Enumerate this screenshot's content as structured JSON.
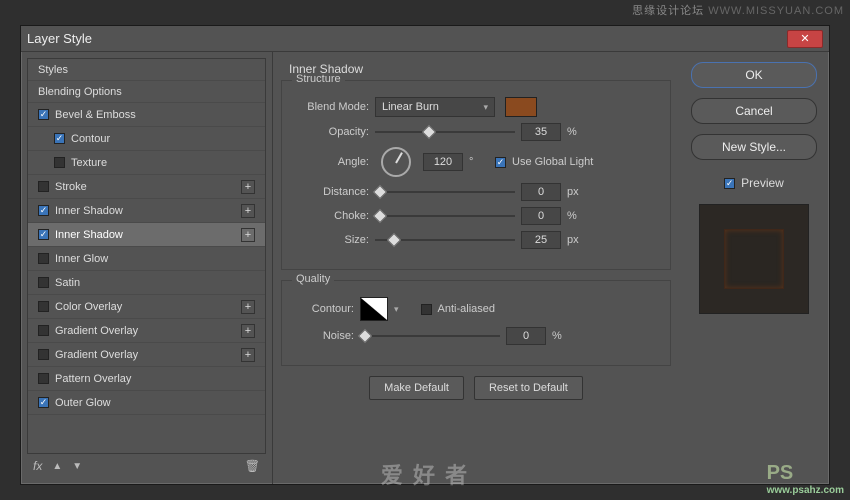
{
  "dialog": {
    "title": "Layer Style"
  },
  "styles": {
    "header0": "Styles",
    "header1": "Blending Options",
    "items": [
      {
        "label": "Bevel & Emboss",
        "checked": true,
        "indent": false,
        "plus": false
      },
      {
        "label": "Contour",
        "checked": true,
        "indent": true,
        "plus": false
      },
      {
        "label": "Texture",
        "checked": false,
        "indent": true,
        "plus": false
      },
      {
        "label": "Stroke",
        "checked": false,
        "indent": false,
        "plus": true
      },
      {
        "label": "Inner Shadow",
        "checked": true,
        "indent": false,
        "plus": true
      },
      {
        "label": "Inner Shadow",
        "checked": true,
        "indent": false,
        "plus": true,
        "selected": true
      },
      {
        "label": "Inner Glow",
        "checked": false,
        "indent": false,
        "plus": false
      },
      {
        "label": "Satin",
        "checked": false,
        "indent": false,
        "plus": false
      },
      {
        "label": "Color Overlay",
        "checked": false,
        "indent": false,
        "plus": true
      },
      {
        "label": "Gradient Overlay",
        "checked": false,
        "indent": false,
        "plus": true
      },
      {
        "label": "Gradient Overlay",
        "checked": false,
        "indent": false,
        "plus": true
      },
      {
        "label": "Pattern Overlay",
        "checked": false,
        "indent": false,
        "plus": false
      },
      {
        "label": "Outer Glow",
        "checked": true,
        "indent": false,
        "plus": false
      }
    ],
    "fx_label": "fx"
  },
  "panel": {
    "title": "Inner Shadow",
    "structure": {
      "legend": "Structure",
      "blend_mode_label": "Blend Mode:",
      "blend_mode_value": "Linear Burn",
      "color": "#8a4a1f",
      "opacity_label": "Opacity:",
      "opacity_value": "35",
      "opacity_unit": "%",
      "angle_label": "Angle:",
      "angle_value": "120",
      "angle_unit": "°",
      "use_global_label": "Use Global Light",
      "use_global_checked": true,
      "distance_label": "Distance:",
      "distance_value": "0",
      "distance_unit": "px",
      "choke_label": "Choke:",
      "choke_value": "0",
      "choke_unit": "%",
      "size_label": "Size:",
      "size_value": "25",
      "size_unit": "px"
    },
    "quality": {
      "legend": "Quality",
      "contour_label": "Contour:",
      "antialiased_label": "Anti-aliased",
      "antialiased_checked": false,
      "noise_label": "Noise:",
      "noise_value": "0",
      "noise_unit": "%"
    },
    "make_default": "Make Default",
    "reset_default": "Reset to Default"
  },
  "right": {
    "ok": "OK",
    "cancel": "Cancel",
    "new_style": "New Style...",
    "preview_label": "Preview",
    "preview_checked": true
  },
  "watermarks": {
    "top_cn": "思缘设计论坛",
    "top_url": "WWW.MISSYUAN.COM",
    "center": "爱 好 者",
    "right_logo": "PS",
    "right_url": "www.psahz.com"
  }
}
